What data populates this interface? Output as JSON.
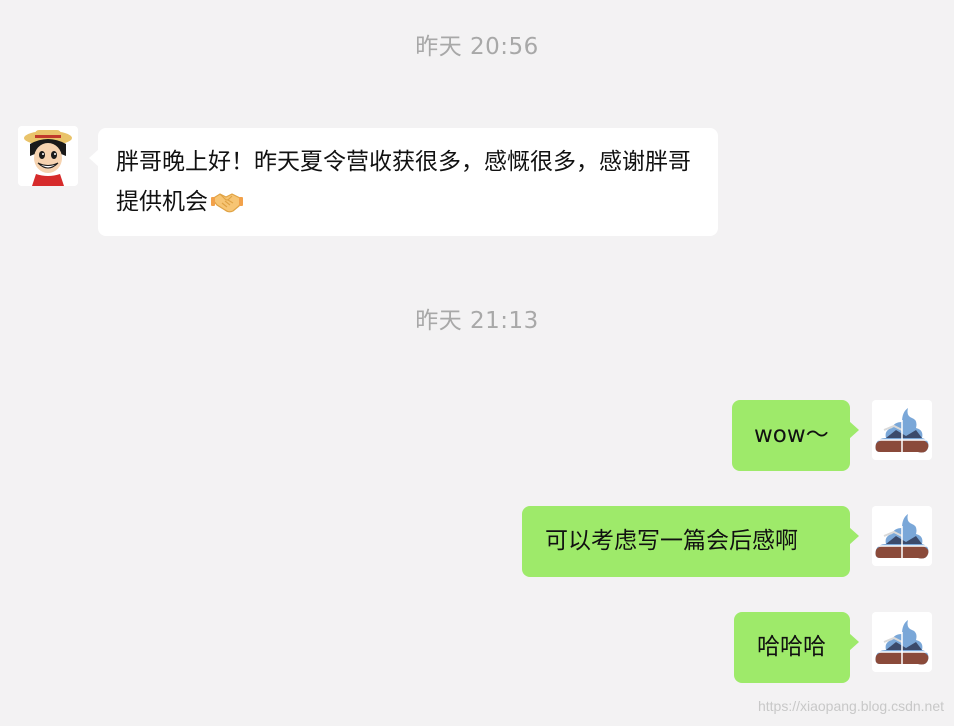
{
  "chat": {
    "timestamp_1": "昨天 20:56",
    "timestamp_2": "昨天 21:13",
    "messages": [
      {
        "sender": "friend",
        "text": "胖哥晚上好！昨天夏令营收获很多，感慨很多，感谢胖哥提供机会",
        "emoji": "handshake-icon"
      },
      {
        "sender": "me",
        "text": "wow～"
      },
      {
        "sender": "me",
        "text": "可以考虑写一篇会后感啊"
      },
      {
        "sender": "me",
        "text": "哈哈哈"
      }
    ]
  },
  "avatars": {
    "friend": "cartoon-pirate-avatar",
    "me": "landscape-photo-avatar"
  },
  "colors": {
    "background": "#f3f2f3",
    "incoming_bubble": "#ffffff",
    "outgoing_bubble": "#9eea6a",
    "timestamp": "#a8a8a8"
  },
  "watermark": "https://xiaopang.blog.csdn.net"
}
